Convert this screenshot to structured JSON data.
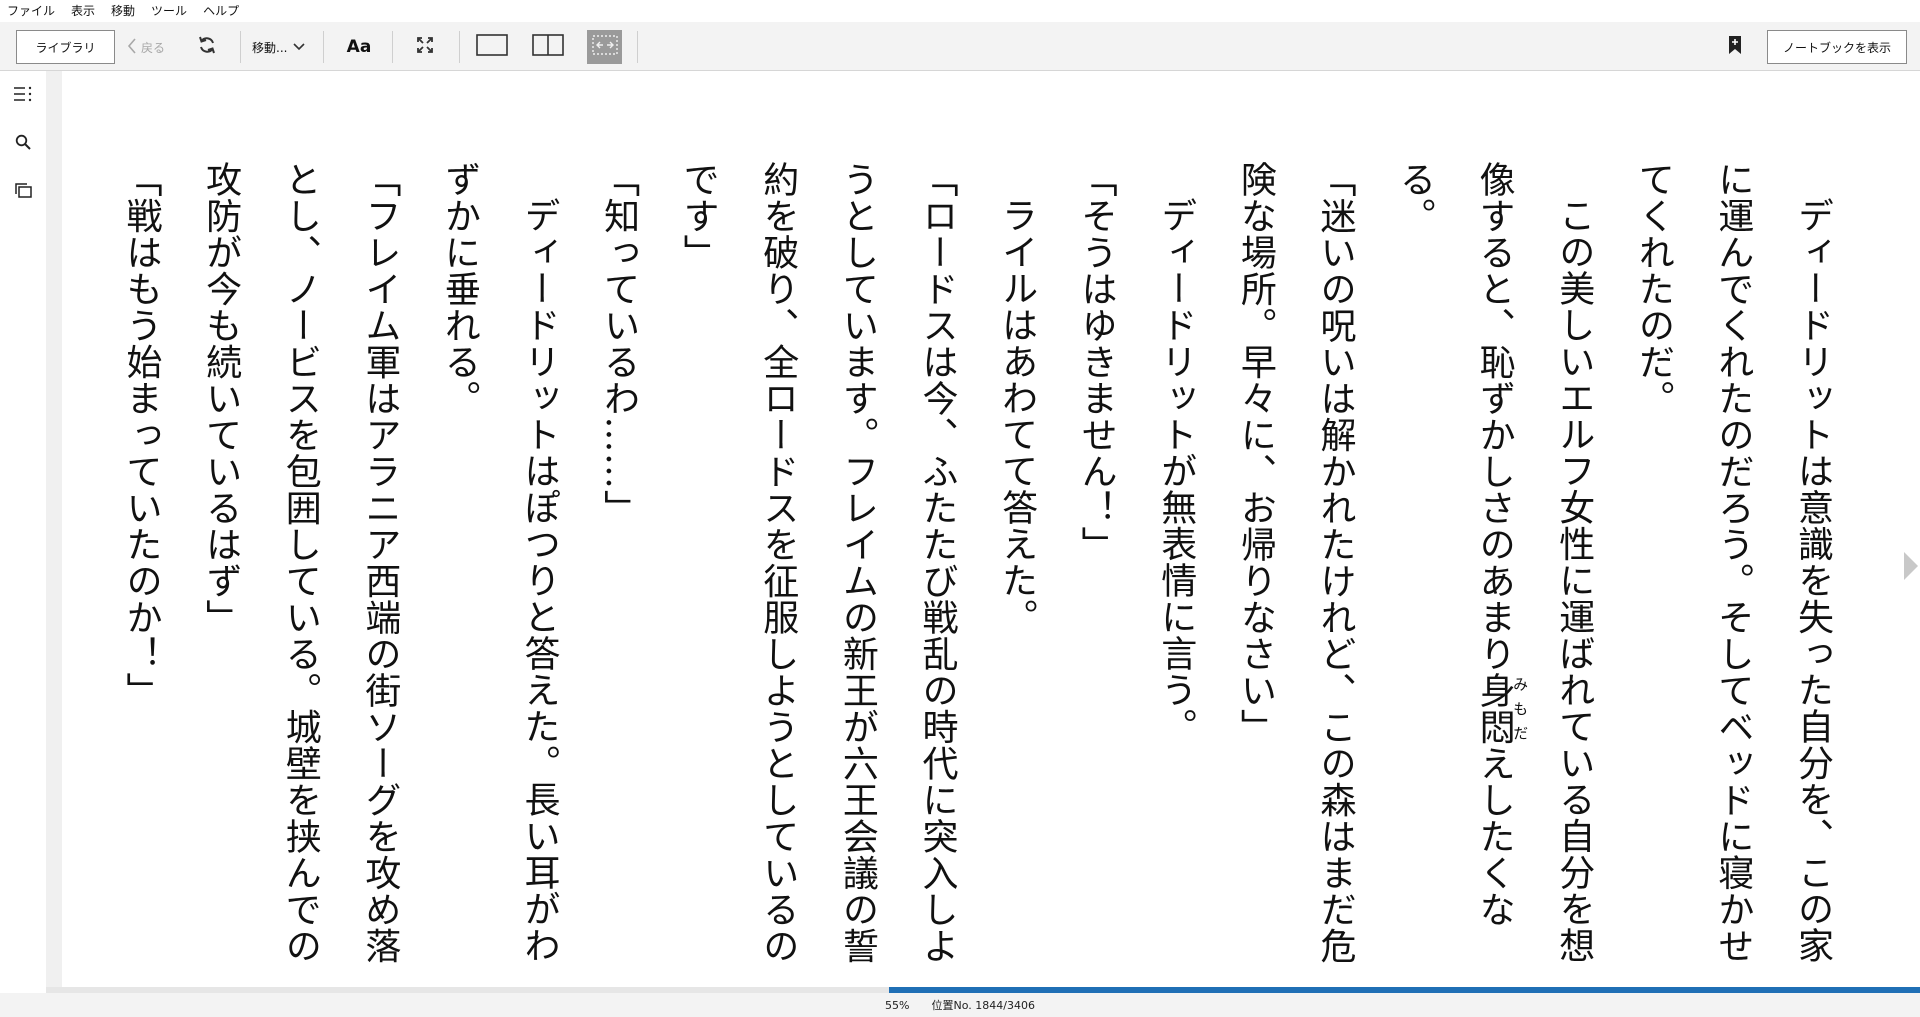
{
  "menu": [
    "ファイル",
    "表示",
    "移動",
    "ツール",
    "ヘルプ"
  ],
  "toolbar": {
    "library_label": "ライブラリ",
    "back_label": "戻る",
    "goto_label": "移動...",
    "font_label": "Aa",
    "notebook_label": "ノートブックを表示"
  },
  "book": {
    "paragraphs": [
      {
        "indent": true,
        "text": "ディードリットは意識を失った自分を、この家に運んでくれたのだろう。そしてベッドに寝かせてくれたのだ。"
      },
      {
        "indent": true,
        "text_before": "この美しいエルフ女性に運ばれている自分を想像すると、恥ずかしさのあまり",
        "ruby_base": "身悶",
        "ruby_text": "みもだ",
        "text_after": "えしたくなる。"
      },
      {
        "indent": false,
        "text": "「迷いの呪いは解かれたけれど、この森はまだ危険な場所。早々に、お帰りなさい」"
      },
      {
        "indent": true,
        "text": "ディードリットが無表情に言う。"
      },
      {
        "indent": false,
        "text": "「そうはゆきません！」"
      },
      {
        "indent": true,
        "text": "ライルはあわてて答えた。"
      },
      {
        "indent": false,
        "text": "「ロードスは今、ふたたび戦乱の時代に突入しようとしています。フレイムの新王が六王会議の誓約を破り、全ロードスを征服しようとしているのです」"
      },
      {
        "indent": false,
        "text": "「知っているわ……」"
      },
      {
        "indent": true,
        "text": "ディードリットはぽつりと答えた。長い耳がわずかに垂れる。"
      },
      {
        "indent": false,
        "text": "「フレイム軍はアラニア西端の街ソーグを攻め落とし、ノービスを包囲している。城壁を挟んでの攻防が今も続いているはず」"
      },
      {
        "indent": false,
        "text": "「戦はもう始まっていたのか！」"
      }
    ]
  },
  "status": {
    "percent": "55%",
    "location": "位置No. 1844/3406",
    "progress_fraction": 0.55
  }
}
